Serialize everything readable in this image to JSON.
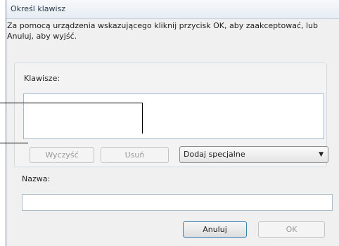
{
  "window": {
    "title": "Określ klawisz"
  },
  "instructions": "Za pomocą urządzenia wskazującego kliknij przycisk OK, aby zaakceptować, lub\nAnuluj, aby wyjść.",
  "keys": {
    "label": "Klawisze:",
    "value": ""
  },
  "buttons": {
    "clear": "Wyczyść",
    "remove": "Usuń",
    "cancel": "Anuluj",
    "ok": "OK"
  },
  "special_select": {
    "selected": "Dodaj specjalne",
    "icon": "chevron-down-icon"
  },
  "name": {
    "label": "Nazwa:",
    "value": ""
  }
}
